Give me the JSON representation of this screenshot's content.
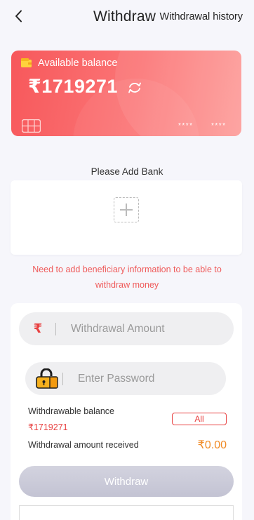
{
  "header": {
    "title": "Withdraw",
    "history_label": "Withdrawal history",
    "back_icon": "chevron-left-icon"
  },
  "balance_card": {
    "label": "Available balance",
    "amount": "₹1719271",
    "card_mask_1": "****",
    "card_mask_2": "****",
    "colors": {
      "gradient_start": "#f7585b",
      "gradient_end": "#fd9e9b"
    },
    "icons": [
      "wallet-icon",
      "refresh-icon",
      "card-chip-icon"
    ]
  },
  "bank": {
    "add_label": "Please Add Bank",
    "add_icon": "dashed-plus-icon",
    "warning": "Need to add beneficiary information to be able to withdraw money"
  },
  "form": {
    "amount_placeholder": "Withdrawal Amount",
    "amount_value": "",
    "currency_symbol": "₹",
    "password_placeholder": "Enter Password",
    "password_value": "",
    "withdrawable_label": "Withdrawable balance",
    "withdrawable_value": "₹1719271",
    "all_label": "All",
    "received_label": "Withdrawal amount received",
    "received_value": "₹0.00",
    "submit_label": "Withdraw"
  },
  "colors": {
    "accent_red": "#e84141",
    "amount_orange": "#f08a24",
    "warning_red": "#ef5b5b",
    "disabled_button": "#c8c8d8"
  }
}
